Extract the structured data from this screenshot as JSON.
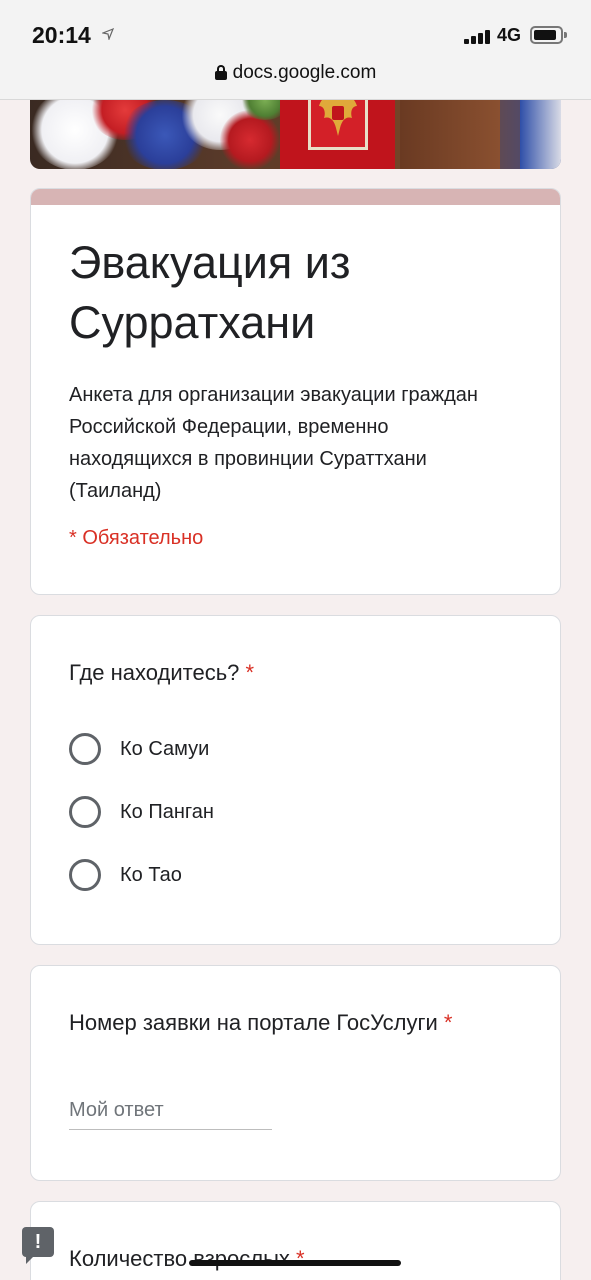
{
  "status_bar": {
    "time": "20:14",
    "network": "4G",
    "location_icon": "location-arrow-icon",
    "signal_icon": "cellular-signal-icon",
    "battery_icon": "battery-icon"
  },
  "browser": {
    "url": "docs.google.com",
    "lock_icon": "lock-icon"
  },
  "form": {
    "title": "Эвакуация из Сурратхани",
    "description": "Анкета для организации эвакуации граждан Российской Федерации, временно находящихся в провинции Сураттхани (Таиланд)",
    "required_note": "* Обязательно",
    "accent_color": "#d7b4b4",
    "required_color": "#d93025"
  },
  "questions": [
    {
      "title": "Где находитесь?",
      "required_mark": "*",
      "options": [
        "Ко Самуи",
        "Ко Панган",
        "Ко Тао"
      ]
    },
    {
      "title": "Номер заявки на портале ГосУслуги",
      "required_mark": "*",
      "placeholder": "Мой ответ",
      "value": ""
    },
    {
      "title": "Количество взрослых",
      "required_mark": "*"
    }
  ],
  "feedback": {
    "label": "!",
    "icon": "feedback-icon"
  }
}
